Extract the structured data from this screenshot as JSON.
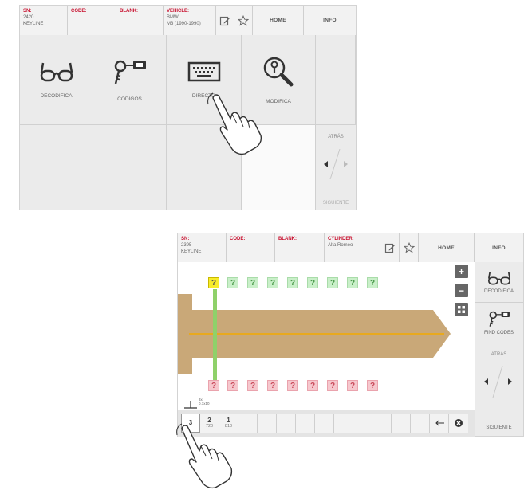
{
  "screen1": {
    "header": {
      "sn_label": "SN:",
      "sn_value": "2420\nKEYLINE",
      "code_label": "CODE:",
      "blank_label": "BLANK:",
      "vehicle_label": "VEHICLE:",
      "vehicle_value": "BMW\nM3 (1990-1990)",
      "home": "HOME",
      "info": "INFO"
    },
    "tiles": [
      {
        "label": "DECODIFICA",
        "icon": "glasses-icon"
      },
      {
        "label": "CÓDIGOS",
        "icon": "key-tag-icon"
      },
      {
        "label": "DIRECTO",
        "icon": "keyboard-icon"
      },
      {
        "label": "MODIFICA",
        "icon": "magnifier-key-icon"
      }
    ],
    "nav": {
      "back": "ATRÁS",
      "next": "SIGUIENTE"
    }
  },
  "screen2": {
    "header": {
      "sn_label": "SN:",
      "sn_value": "2395\nKEYLINE",
      "code_label": "CODE:",
      "blank_label": "BLANK:",
      "cylinder_label": "CYLINDER:",
      "cylinder_value": "Alfa Romeo",
      "home": "HOME",
      "info": "INFO"
    },
    "cut_mark": "?",
    "side": {
      "decode": "DECODIFICA",
      "find_codes": "FIND CODES",
      "back": "ATRÁS",
      "next": "SIGUIENTE"
    },
    "depths": [
      {
        "value": "3",
        "sub": ""
      },
      {
        "value": "2",
        "sub": "720"
      },
      {
        "value": "1",
        "sub": "810"
      }
    ],
    "scale_label": "3x\n0.1x10",
    "colors": {
      "key": "#c9a878",
      "cut_line": "#f2a900",
      "selected_marker": "#8fd16a",
      "selected_box": "#f7ec2a"
    }
  }
}
